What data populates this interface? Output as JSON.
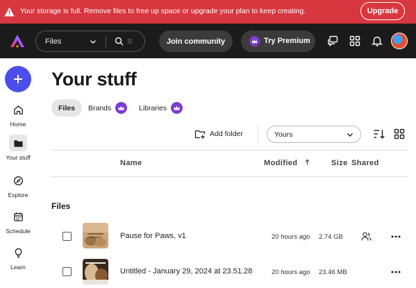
{
  "banner": {
    "message": "Your storage is full. Remove files to free up space or upgrade your plan to keep creating.",
    "upgrade_label": "Upgrade",
    "color": "#d7373f"
  },
  "topnav": {
    "logo_icon": "adobe-express-logo",
    "search_scope": "Files",
    "search_placeholder": "S",
    "join_label": "Join community",
    "premium_label": "Try Premium",
    "icons": [
      "chat-icon",
      "apps-grid-icon",
      "bell-icon",
      "avatar"
    ]
  },
  "rail": {
    "create_icon": "plus-icon",
    "items": [
      {
        "label": "Home",
        "icon": "home-icon"
      },
      {
        "label": "Your stuff",
        "icon": "folder-icon",
        "active": true
      },
      {
        "label": "Explore",
        "icon": "explore-icon"
      },
      {
        "label": "Schedule",
        "icon": "calendar-icon"
      },
      {
        "label": "Learn",
        "icon": "bulb-icon"
      }
    ]
  },
  "main": {
    "title": "Your stuff",
    "tabs": [
      {
        "label": "Files",
        "active": true
      },
      {
        "label": "Brands",
        "premium": true
      },
      {
        "label": "Libraries",
        "premium": true
      }
    ],
    "toolbar": {
      "add_folder_label": "Add folder",
      "owner_filter": "Yours"
    },
    "columns": {
      "name": "Name",
      "modified": "Modified",
      "size": "Size",
      "shared": "Shared"
    },
    "section_title": "Files",
    "files": [
      {
        "name": "Pause for Paws, v1",
        "modified": "20 hours ago",
        "size": "2.74 GB",
        "shared": true
      },
      {
        "name": "Untitled - January 29, 2024 at 23.51.28",
        "modified": "20 hours ago",
        "size": "23.46 MB",
        "shared": false
      }
    ]
  }
}
